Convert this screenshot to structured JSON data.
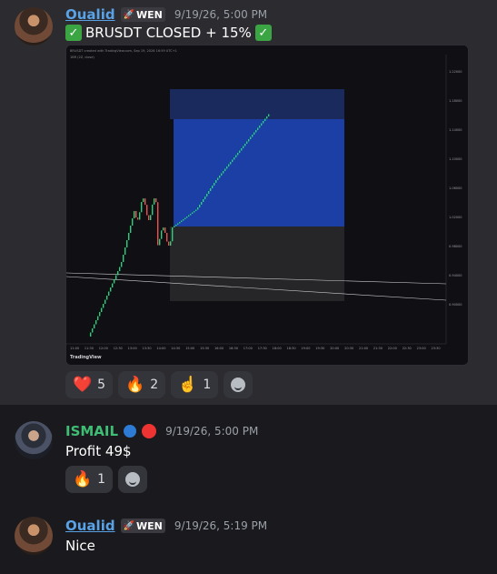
{
  "messages": [
    {
      "username": "Oualid",
      "tag": "WEN",
      "timestamp": "9/19/26, 5:00 PM",
      "text": "BRUSDT CLOSED + 15%",
      "reactions": [
        {
          "emoji": "❤️",
          "count": "5"
        },
        {
          "emoji": "🔥",
          "count": "2"
        },
        {
          "emoji": "☝️",
          "count": "1"
        }
      ]
    },
    {
      "username": "ISMAIL",
      "timestamp": "9/19/26, 5:00 PM",
      "text": "Profit 49$",
      "reactions": [
        {
          "emoji": "🔥",
          "count": "1"
        }
      ]
    },
    {
      "username": "Oualid",
      "tag": "WEN",
      "timestamp": "9/19/26, 5:19 PM",
      "text": "Nice"
    }
  ],
  "chart": {
    "title": "BRUSDT created with TradingView.com, Sep 19, 2026 16:59 UTC+1",
    "symbol": "1BR (2Z, close)",
    "watermark": "TradingView",
    "price_labels": [
      "1.22000",
      "1.18000",
      "1.14000",
      "1.10000",
      "1.06000",
      "1.02000",
      "0.98000",
      "0.94000",
      "0.90000"
    ],
    "time_labels": [
      "11:00",
      "11:30",
      "12:00",
      "12:30",
      "13:00",
      "13:30",
      "14:00",
      "14:30",
      "15:00",
      "15:30",
      "16:00",
      "16:30",
      "17:00",
      "17:30",
      "18:00",
      "18:30",
      "19:00",
      "19:30",
      "20:00",
      "20:30",
      "21:00",
      "21:30",
      "22:00",
      "22:30",
      "23:00",
      "23:30"
    ]
  }
}
